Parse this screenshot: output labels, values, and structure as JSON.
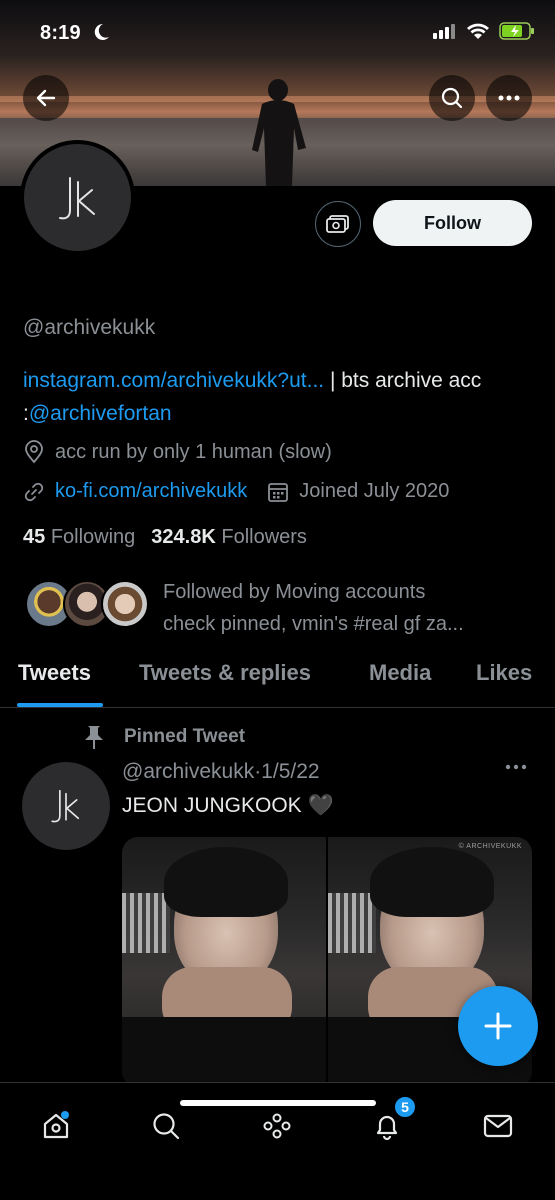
{
  "status_bar": {
    "time": "8:19"
  },
  "profile": {
    "avatar_monogram": "Jk",
    "follow_label": "Follow",
    "handle": "@archivekukk",
    "bio_link": "instagram.com/archivekukk?ut...",
    "bio_text_1": " | bts archive acc :",
    "bio_mention": "@archivefortan",
    "location": "acc run by only 1 human (slow)",
    "website": "ko-fi.com/archivekukk",
    "joined": "Joined July 2020",
    "following_count": "45",
    "following_label": "Following",
    "followers_count": "324.8K",
    "followers_label": "Followers",
    "followed_by_line1": "Followed by Moving accounts",
    "followed_by_line2": "check pinned, vmin's #real gf za..."
  },
  "tabs": [
    "Tweets",
    "Tweets & replies",
    "Media",
    "Likes"
  ],
  "tweet": {
    "pinned_label": "Pinned Tweet",
    "handle_date": "@archivekukk·1/5/22",
    "text": "JEON JUNGKOOK 🖤",
    "watermark": "© ARCHIVEKUKK"
  },
  "nav": {
    "notifications_badge": "5"
  },
  "colors": {
    "accent": "#1d9bf0",
    "background": "#000000",
    "muted": "#8b9096"
  },
  "icons": [
    "back-arrow-icon",
    "search-icon",
    "more-icon",
    "tip-jar-icon",
    "location-icon",
    "link-icon",
    "calendar-icon",
    "pin-icon",
    "home-icon",
    "explore-icon",
    "spaces-icon",
    "bell-icon",
    "mail-icon",
    "compose-plus-icon"
  ]
}
